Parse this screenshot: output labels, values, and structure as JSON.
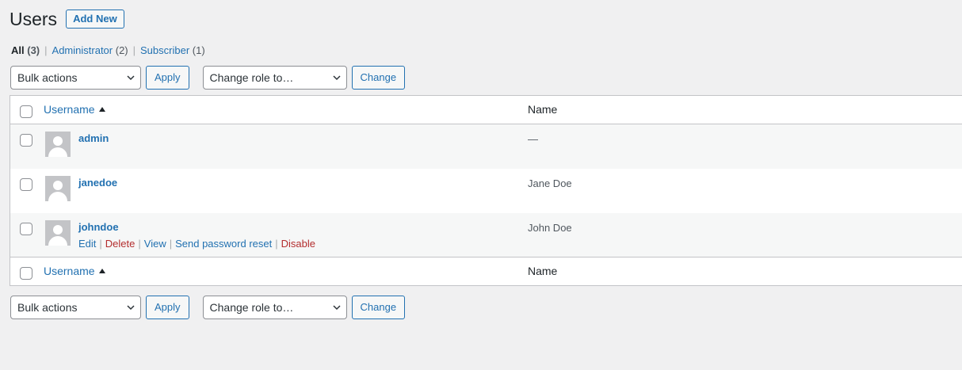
{
  "page": {
    "title": "Users",
    "add_new_label": "Add New"
  },
  "views": [
    {
      "label": "All",
      "count": "(3)",
      "current": true
    },
    {
      "label": "Administrator",
      "count": "(2)",
      "current": false
    },
    {
      "label": "Subscriber",
      "count": "(1)",
      "current": false
    }
  ],
  "views_separator": "|",
  "tablenav": {
    "bulk_actions": "Bulk actions",
    "apply_label": "Apply",
    "change_role": "Change role to…",
    "change_label": "Change"
  },
  "table": {
    "col_username": "Username",
    "col_name": "Name",
    "rows": [
      {
        "username": "admin",
        "name": "—"
      },
      {
        "username": "janedoe",
        "name": "Jane Doe"
      },
      {
        "username": "johndoe",
        "name": "John Doe"
      }
    ]
  },
  "row_actions": {
    "edit": "Edit",
    "delete": "Delete",
    "view": "View",
    "send_reset": "Send password reset",
    "disable": "Disable",
    "separator": "|"
  },
  "colors": {
    "link": "#2271b1",
    "danger": "#b32d2e",
    "background": "#f0f0f1"
  },
  "icons": {
    "sort": "sort-ascending-icon",
    "dropdown": "chevron-down-icon",
    "avatar": "default-avatar-icon"
  }
}
